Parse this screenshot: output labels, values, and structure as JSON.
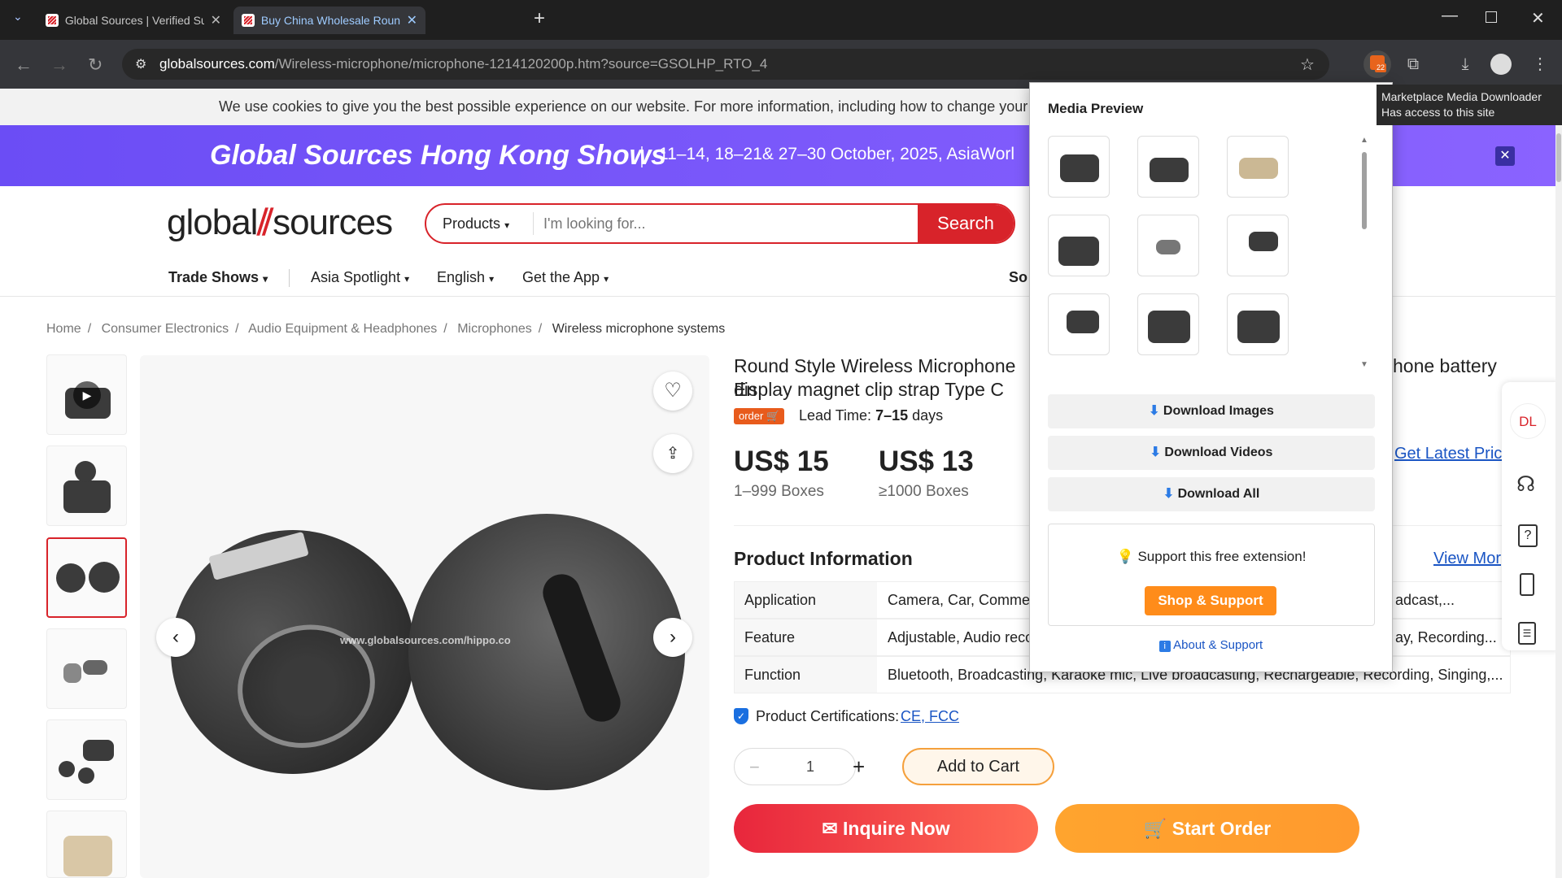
{
  "browser": {
    "tabs": [
      {
        "title": "Global Sources | Verified Suppli",
        "active": false
      },
      {
        "title": "Buy China Wholesale Round Sty",
        "active": true
      }
    ],
    "url_host": "globalsources.com",
    "url_path": "/Wireless-microphone/microphone-1214120200p.htm?source=GSOLHP_RTO_4",
    "extension_badge": "22"
  },
  "cookie_notice": "We use cookies to give you the best possible experience on our website. For more information, including how to change your coo",
  "banner": {
    "title": "Global Sources Hong Kong Shows",
    "dates": "11–14, 18–21& 27–30 October, 2025, AsiaWorl",
    "close": "✕"
  },
  "header": {
    "logo_left": "global",
    "logo_right": "sources",
    "search_category": "Products",
    "search_placeholder": "I'm looking for...",
    "search_button": "Search",
    "nav": [
      "Trade Shows",
      "Asia Spotlight",
      "English",
      "Get the App"
    ],
    "nav_cut": "So"
  },
  "breadcrumb": [
    "Home",
    "Consumer Electronics",
    "Audio Equipment & Headphones",
    "Microphones",
    "Wireless microphone systems"
  ],
  "product": {
    "title_left": "Round Style Wireless Microphone En",
    "title_right": "hone battery",
    "title_line2": "display magnet clip strap Type C",
    "order_badge": "order",
    "lead_time_label": "Lead Time:",
    "lead_time_value": "7–15",
    "lead_time_unit": "days",
    "watermark": "www.globalsources.com/hippo.co",
    "prices": [
      {
        "price": "US$ 15",
        "qty": "1–999 Boxes"
      },
      {
        "price": "US$ 13",
        "qty": "≥1000 Boxes"
      }
    ],
    "get_latest_price": "Get Latest Pric",
    "info_heading": "Product Information",
    "view_more": "View Mor",
    "specs": [
      {
        "key": "Application",
        "value": "Camera, Car, Commerc",
        "value_right": "adcast,..."
      },
      {
        "key": "Feature",
        "value": "Adjustable, Audio reco",
        "value_right": "ay, Recording..."
      },
      {
        "key": "Function",
        "value": "Bluetooth, Broadcasting, Karaoke mic, Live broadcasting, Rechargeable, Recording, Singing,..."
      }
    ],
    "certifications_label": "Product Certifications:",
    "certifications": "CE, FCC",
    "quantity": "1",
    "add_to_cart": "Add to Cart",
    "inquire": "Inquire Now",
    "start_order": "Start Order"
  },
  "popup": {
    "title": "Media Preview",
    "download_images": "Download Images",
    "download_videos": "Download Videos",
    "download_all": "Download All",
    "support_text": "Support this free extension!",
    "shop_support": "Shop & Support",
    "about_support": "About & Support"
  },
  "tooltip": {
    "line1": "Marketplace Media Downloader",
    "line2": "Has access to this site"
  },
  "rail": {
    "dl": "DL"
  },
  "colors": {
    "brand_red": "#d8232a",
    "banner_purple": "#7b58fb",
    "order_orange": "#ff9a2e",
    "popup_orange": "#ff8c1a"
  }
}
